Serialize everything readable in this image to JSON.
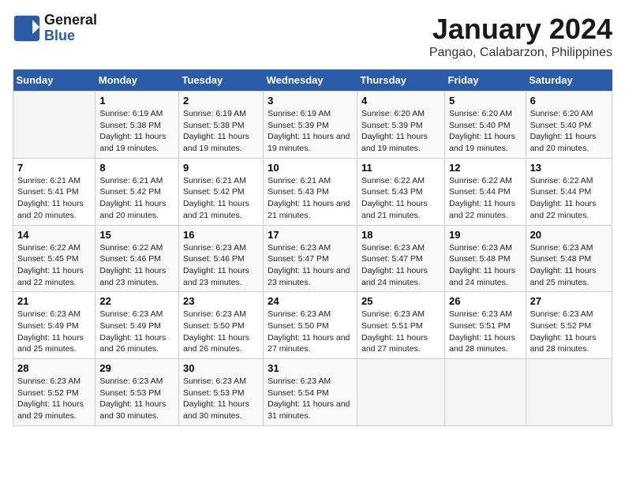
{
  "header": {
    "logo_line1": "General",
    "logo_line2": "Blue",
    "main_title": "January 2024",
    "subtitle": "Pangao, Calabarzon, Philippines"
  },
  "days_of_week": [
    "Sunday",
    "Monday",
    "Tuesday",
    "Wednesday",
    "Thursday",
    "Friday",
    "Saturday"
  ],
  "weeks": [
    [
      {
        "num": "",
        "sunrise": "",
        "sunset": "",
        "daylight": ""
      },
      {
        "num": "1",
        "sunrise": "Sunrise: 6:19 AM",
        "sunset": "Sunset: 5:38 PM",
        "daylight": "Daylight: 11 hours and 19 minutes."
      },
      {
        "num": "2",
        "sunrise": "Sunrise: 6:19 AM",
        "sunset": "Sunset: 5:38 PM",
        "daylight": "Daylight: 11 hours and 19 minutes."
      },
      {
        "num": "3",
        "sunrise": "Sunrise: 6:19 AM",
        "sunset": "Sunset: 5:39 PM",
        "daylight": "Daylight: 11 hours and 19 minutes."
      },
      {
        "num": "4",
        "sunrise": "Sunrise: 6:20 AM",
        "sunset": "Sunset: 5:39 PM",
        "daylight": "Daylight: 11 hours and 19 minutes."
      },
      {
        "num": "5",
        "sunrise": "Sunrise: 6:20 AM",
        "sunset": "Sunset: 5:40 PM",
        "daylight": "Daylight: 11 hours and 19 minutes."
      },
      {
        "num": "6",
        "sunrise": "Sunrise: 6:20 AM",
        "sunset": "Sunset: 5:40 PM",
        "daylight": "Daylight: 11 hours and 20 minutes."
      }
    ],
    [
      {
        "num": "7",
        "sunrise": "Sunrise: 6:21 AM",
        "sunset": "Sunset: 5:41 PM",
        "daylight": "Daylight: 11 hours and 20 minutes."
      },
      {
        "num": "8",
        "sunrise": "Sunrise: 6:21 AM",
        "sunset": "Sunset: 5:42 PM",
        "daylight": "Daylight: 11 hours and 20 minutes."
      },
      {
        "num": "9",
        "sunrise": "Sunrise: 6:21 AM",
        "sunset": "Sunset: 5:42 PM",
        "daylight": "Daylight: 11 hours and 21 minutes."
      },
      {
        "num": "10",
        "sunrise": "Sunrise: 6:21 AM",
        "sunset": "Sunset: 5:43 PM",
        "daylight": "Daylight: 11 hours and 21 minutes."
      },
      {
        "num": "11",
        "sunrise": "Sunrise: 6:22 AM",
        "sunset": "Sunset: 5:43 PM",
        "daylight": "Daylight: 11 hours and 21 minutes."
      },
      {
        "num": "12",
        "sunrise": "Sunrise: 6:22 AM",
        "sunset": "Sunset: 5:44 PM",
        "daylight": "Daylight: 11 hours and 22 minutes."
      },
      {
        "num": "13",
        "sunrise": "Sunrise: 6:22 AM",
        "sunset": "Sunset: 5:44 PM",
        "daylight": "Daylight: 11 hours and 22 minutes."
      }
    ],
    [
      {
        "num": "14",
        "sunrise": "Sunrise: 6:22 AM",
        "sunset": "Sunset: 5:45 PM",
        "daylight": "Daylight: 11 hours and 22 minutes."
      },
      {
        "num": "15",
        "sunrise": "Sunrise: 6:22 AM",
        "sunset": "Sunset: 5:46 PM",
        "daylight": "Daylight: 11 hours and 23 minutes."
      },
      {
        "num": "16",
        "sunrise": "Sunrise: 6:23 AM",
        "sunset": "Sunset: 5:46 PM",
        "daylight": "Daylight: 11 hours and 23 minutes."
      },
      {
        "num": "17",
        "sunrise": "Sunrise: 6:23 AM",
        "sunset": "Sunset: 5:47 PM",
        "daylight": "Daylight: 11 hours and 23 minutes."
      },
      {
        "num": "18",
        "sunrise": "Sunrise: 6:23 AM",
        "sunset": "Sunset: 5:47 PM",
        "daylight": "Daylight: 11 hours and 24 minutes."
      },
      {
        "num": "19",
        "sunrise": "Sunrise: 6:23 AM",
        "sunset": "Sunset: 5:48 PM",
        "daylight": "Daylight: 11 hours and 24 minutes."
      },
      {
        "num": "20",
        "sunrise": "Sunrise: 6:23 AM",
        "sunset": "Sunset: 5:48 PM",
        "daylight": "Daylight: 11 hours and 25 minutes."
      }
    ],
    [
      {
        "num": "21",
        "sunrise": "Sunrise: 6:23 AM",
        "sunset": "Sunset: 5:49 PM",
        "daylight": "Daylight: 11 hours and 25 minutes."
      },
      {
        "num": "22",
        "sunrise": "Sunrise: 6:23 AM",
        "sunset": "Sunset: 5:49 PM",
        "daylight": "Daylight: 11 hours and 26 minutes."
      },
      {
        "num": "23",
        "sunrise": "Sunrise: 6:23 AM",
        "sunset": "Sunset: 5:50 PM",
        "daylight": "Daylight: 11 hours and 26 minutes."
      },
      {
        "num": "24",
        "sunrise": "Sunrise: 6:23 AM",
        "sunset": "Sunset: 5:50 PM",
        "daylight": "Daylight: 11 hours and 27 minutes."
      },
      {
        "num": "25",
        "sunrise": "Sunrise: 6:23 AM",
        "sunset": "Sunset: 5:51 PM",
        "daylight": "Daylight: 11 hours and 27 minutes."
      },
      {
        "num": "26",
        "sunrise": "Sunrise: 6:23 AM",
        "sunset": "Sunset: 5:51 PM",
        "daylight": "Daylight: 11 hours and 28 minutes."
      },
      {
        "num": "27",
        "sunrise": "Sunrise: 6:23 AM",
        "sunset": "Sunset: 5:52 PM",
        "daylight": "Daylight: 11 hours and 28 minutes."
      }
    ],
    [
      {
        "num": "28",
        "sunrise": "Sunrise: 6:23 AM",
        "sunset": "Sunset: 5:52 PM",
        "daylight": "Daylight: 11 hours and 29 minutes."
      },
      {
        "num": "29",
        "sunrise": "Sunrise: 6:23 AM",
        "sunset": "Sunset: 5:53 PM",
        "daylight": "Daylight: 11 hours and 30 minutes."
      },
      {
        "num": "30",
        "sunrise": "Sunrise: 6:23 AM",
        "sunset": "Sunset: 5:53 PM",
        "daylight": "Daylight: 11 hours and 30 minutes."
      },
      {
        "num": "31",
        "sunrise": "Sunrise: 6:23 AM",
        "sunset": "Sunset: 5:54 PM",
        "daylight": "Daylight: 11 hours and 31 minutes."
      },
      {
        "num": "",
        "sunrise": "",
        "sunset": "",
        "daylight": ""
      },
      {
        "num": "",
        "sunrise": "",
        "sunset": "",
        "daylight": ""
      },
      {
        "num": "",
        "sunrise": "",
        "sunset": "",
        "daylight": ""
      }
    ]
  ]
}
